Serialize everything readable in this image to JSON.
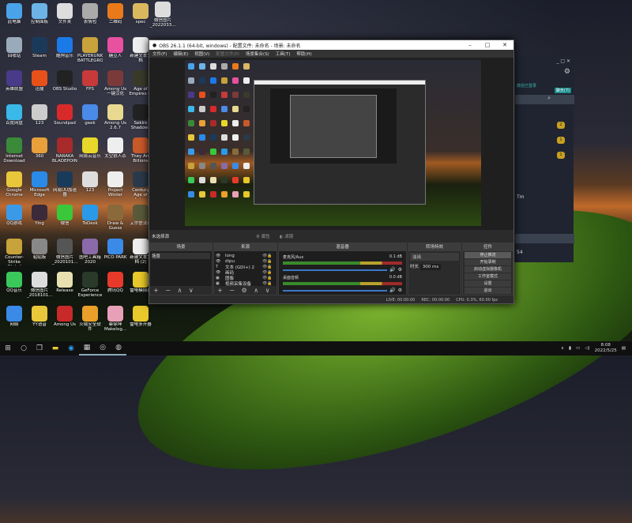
{
  "desktop": {
    "icons": [
      [
        "此电脑",
        "#4aa3e8"
      ],
      [
        "控制面板",
        "#6cb4e8"
      ],
      [
        "文件夹",
        "#ddd"
      ],
      [
        "表情包",
        "#aaa"
      ],
      [
        "二维码",
        "#e87a1a"
      ],
      [
        "spec",
        "#d9b860"
      ],
      [
        "回收站",
        "#9ab"
      ],
      [
        "Steam",
        "#1b3a5a"
      ],
      [
        "酷狗音乐",
        "#1a7ae8"
      ],
      [
        "PLAYERUNKNOWN'S BATTLEGROUNDS",
        "#c8a23a"
      ],
      [
        "糖豆人",
        "#e850a0"
      ],
      [
        "新建文本文档",
        "#eee"
      ],
      [
        "英雄联盟",
        "#4a3a8a"
      ],
      [
        "迅捷",
        "#e8501a"
      ],
      [
        "OBS Studio",
        "#222"
      ],
      [
        "FPS",
        "#c83a3a"
      ],
      [
        "Among Us 一键汉化",
        "#7a3a3a"
      ],
      [
        "Age of Empires IV",
        "#3a3a2a"
      ],
      [
        "百度网盘",
        "#3ab8e8"
      ],
      [
        "123",
        "#ccc"
      ],
      [
        "Soundpad",
        "#d82a2a"
      ],
      [
        "geek",
        "#4a8ae8"
      ],
      [
        "Among Us 2.6.7",
        "#e8d890"
      ],
      [
        "Sekiro Shadows",
        "#222"
      ],
      [
        "Internet Download",
        "#3a8a3a"
      ],
      [
        "360",
        "#e8a03a"
      ],
      [
        "NARAKA BLADEPOINT",
        "#a82a2a"
      ],
      [
        "网易云音乐",
        "#e8d82a"
      ],
      [
        "太空狼人杀",
        "#eee"
      ],
      [
        "They Are Billions",
        "#c85a2a"
      ],
      [
        "Google Chrome",
        "#e8c83a"
      ],
      [
        "Microsoft Edge",
        "#2a8ae8"
      ],
      [
        "网易UU加速器",
        "#1a3a5a"
      ],
      [
        "123",
        "#ddd"
      ],
      [
        "Project Winter",
        "#eee"
      ],
      [
        "Century Age of Ashes",
        "#2a3a4a"
      ],
      [
        "QQ游戏",
        "#3a9ae8"
      ],
      [
        "Ying",
        "#3a2a3a"
      ],
      [
        "微信",
        "#3ac83a"
      ],
      [
        "ToDesk",
        "#2a9ae8"
      ],
      [
        "Draw & Guess",
        "#8a6a3a"
      ],
      [
        "艾尔登法环",
        "#5a5a3a"
      ],
      [
        "Counter-Strike Global Off...",
        "#c8a23a"
      ],
      [
        "粘贴板",
        "#888"
      ],
      [
        "微信图片_2020101...",
        "#555"
      ],
      [
        "图吧工具箱 2020",
        "#8a6aa8"
      ],
      [
        "PICO PARK",
        "#3a8ae8"
      ],
      [
        "新建文本文档 (2)",
        "#eee"
      ],
      [
        "QQ音乐",
        "#3ac85a"
      ],
      [
        "微信图片_2018101...",
        "#ddd"
      ],
      [
        "Release",
        "#e8e0b0"
      ],
      [
        "GeForce Experience",
        "#2a3a2a"
      ],
      [
        "腾讯QQ",
        "#e83a2a"
      ],
      [
        "雷电模拟器",
        "#e8c82a"
      ],
      [
        "网络",
        "#3a8ae8"
      ],
      [
        "YY语音",
        "#e8c83a"
      ],
      [
        "Among Us",
        "#c82a2a"
      ],
      [
        "火绒安全软件",
        "#e8a02a"
      ],
      [
        "蔡徐坤 Makelog...",
        "#e8a0b8"
      ],
      [
        "雷电多开器",
        "#e8c82a"
      ]
    ],
    "extra_icon": "微信图片_2022033..."
  },
  "obs": {
    "title": "OBS 26.1.1 (64-bit, windows) - 配置文件: 未命名 - 场景: 未命名",
    "menu": [
      "文件(F)",
      "编辑(E)",
      "视图(V)",
      "配置文件(P)",
      "场景集合(S)",
      "工具(T)",
      "帮助(H)"
    ],
    "no_source": "未选择源",
    "properties": "属性",
    "filters": "滤镜",
    "scenes": {
      "title": "场景",
      "items": [
        "场景"
      ]
    },
    "sources": {
      "title": "来源",
      "items": [
        [
          "long",
          "👁"
        ],
        [
          "dipu",
          "👁"
        ],
        [
          "文本 (GDI+) 2",
          "T"
        ],
        [
          "画码",
          "👁"
        ],
        [
          "图像",
          "▣"
        ],
        [
          "视频采集设备",
          "▣"
        ]
      ]
    },
    "mixer": {
      "title": "混音器",
      "channels": [
        {
          "name": "麦克风/Aux",
          "db": "0.1 dB"
        },
        {
          "name": "桌面音频",
          "db": "0.0 dB"
        }
      ]
    },
    "transitions": {
      "title": "转场特效",
      "type": "淡出",
      "duration_label": "时长",
      "duration": "300 ms"
    },
    "controls": {
      "title": "控件",
      "buttons": [
        "停止推流",
        "开始录制",
        "启动虚拟摄像机",
        "工作室模式",
        "设置",
        "退出"
      ]
    },
    "status": {
      "live": "LIVE: 00:00:00",
      "rec": "REC: 00:00:00",
      "cpu": "CPU: 0.3%, 60.00 fps"
    }
  },
  "qq": {
    "badges": [
      "2",
      "1",
      "1"
    ],
    "notice": "微信已登录",
    "button": "聊天(7)",
    "tm": "Tm",
    "num": "54"
  },
  "taskbar": {
    "time": "8:08",
    "date": "2022/5/25"
  }
}
